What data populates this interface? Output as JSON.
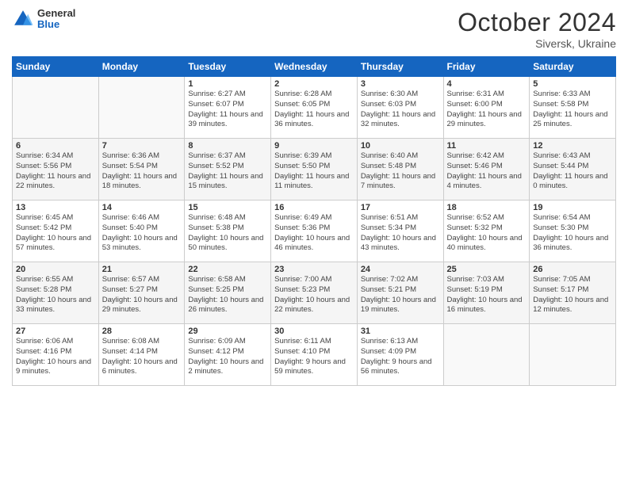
{
  "header": {
    "logo": {
      "general": "General",
      "blue": "Blue"
    },
    "title": "October 2024",
    "location": "Siversk, Ukraine"
  },
  "weekdays": [
    "Sunday",
    "Monday",
    "Tuesday",
    "Wednesday",
    "Thursday",
    "Friday",
    "Saturday"
  ],
  "weeks": [
    [
      {
        "day": "",
        "detail": ""
      },
      {
        "day": "",
        "detail": ""
      },
      {
        "day": "1",
        "detail": "Sunrise: 6:27 AM\nSunset: 6:07 PM\nDaylight: 11 hours and 39 minutes."
      },
      {
        "day": "2",
        "detail": "Sunrise: 6:28 AM\nSunset: 6:05 PM\nDaylight: 11 hours and 36 minutes."
      },
      {
        "day": "3",
        "detail": "Sunrise: 6:30 AM\nSunset: 6:03 PM\nDaylight: 11 hours and 32 minutes."
      },
      {
        "day": "4",
        "detail": "Sunrise: 6:31 AM\nSunset: 6:00 PM\nDaylight: 11 hours and 29 minutes."
      },
      {
        "day": "5",
        "detail": "Sunrise: 6:33 AM\nSunset: 5:58 PM\nDaylight: 11 hours and 25 minutes."
      }
    ],
    [
      {
        "day": "6",
        "detail": "Sunrise: 6:34 AM\nSunset: 5:56 PM\nDaylight: 11 hours and 22 minutes."
      },
      {
        "day": "7",
        "detail": "Sunrise: 6:36 AM\nSunset: 5:54 PM\nDaylight: 11 hours and 18 minutes."
      },
      {
        "day": "8",
        "detail": "Sunrise: 6:37 AM\nSunset: 5:52 PM\nDaylight: 11 hours and 15 minutes."
      },
      {
        "day": "9",
        "detail": "Sunrise: 6:39 AM\nSunset: 5:50 PM\nDaylight: 11 hours and 11 minutes."
      },
      {
        "day": "10",
        "detail": "Sunrise: 6:40 AM\nSunset: 5:48 PM\nDaylight: 11 hours and 7 minutes."
      },
      {
        "day": "11",
        "detail": "Sunrise: 6:42 AM\nSunset: 5:46 PM\nDaylight: 11 hours and 4 minutes."
      },
      {
        "day": "12",
        "detail": "Sunrise: 6:43 AM\nSunset: 5:44 PM\nDaylight: 11 hours and 0 minutes."
      }
    ],
    [
      {
        "day": "13",
        "detail": "Sunrise: 6:45 AM\nSunset: 5:42 PM\nDaylight: 10 hours and 57 minutes."
      },
      {
        "day": "14",
        "detail": "Sunrise: 6:46 AM\nSunset: 5:40 PM\nDaylight: 10 hours and 53 minutes."
      },
      {
        "day": "15",
        "detail": "Sunrise: 6:48 AM\nSunset: 5:38 PM\nDaylight: 10 hours and 50 minutes."
      },
      {
        "day": "16",
        "detail": "Sunrise: 6:49 AM\nSunset: 5:36 PM\nDaylight: 10 hours and 46 minutes."
      },
      {
        "day": "17",
        "detail": "Sunrise: 6:51 AM\nSunset: 5:34 PM\nDaylight: 10 hours and 43 minutes."
      },
      {
        "day": "18",
        "detail": "Sunrise: 6:52 AM\nSunset: 5:32 PM\nDaylight: 10 hours and 40 minutes."
      },
      {
        "day": "19",
        "detail": "Sunrise: 6:54 AM\nSunset: 5:30 PM\nDaylight: 10 hours and 36 minutes."
      }
    ],
    [
      {
        "day": "20",
        "detail": "Sunrise: 6:55 AM\nSunset: 5:28 PM\nDaylight: 10 hours and 33 minutes."
      },
      {
        "day": "21",
        "detail": "Sunrise: 6:57 AM\nSunset: 5:27 PM\nDaylight: 10 hours and 29 minutes."
      },
      {
        "day": "22",
        "detail": "Sunrise: 6:58 AM\nSunset: 5:25 PM\nDaylight: 10 hours and 26 minutes."
      },
      {
        "day": "23",
        "detail": "Sunrise: 7:00 AM\nSunset: 5:23 PM\nDaylight: 10 hours and 22 minutes."
      },
      {
        "day": "24",
        "detail": "Sunrise: 7:02 AM\nSunset: 5:21 PM\nDaylight: 10 hours and 19 minutes."
      },
      {
        "day": "25",
        "detail": "Sunrise: 7:03 AM\nSunset: 5:19 PM\nDaylight: 10 hours and 16 minutes."
      },
      {
        "day": "26",
        "detail": "Sunrise: 7:05 AM\nSunset: 5:17 PM\nDaylight: 10 hours and 12 minutes."
      }
    ],
    [
      {
        "day": "27",
        "detail": "Sunrise: 6:06 AM\nSunset: 4:16 PM\nDaylight: 10 hours and 9 minutes."
      },
      {
        "day": "28",
        "detail": "Sunrise: 6:08 AM\nSunset: 4:14 PM\nDaylight: 10 hours and 6 minutes."
      },
      {
        "day": "29",
        "detail": "Sunrise: 6:09 AM\nSunset: 4:12 PM\nDaylight: 10 hours and 2 minutes."
      },
      {
        "day": "30",
        "detail": "Sunrise: 6:11 AM\nSunset: 4:10 PM\nDaylight: 9 hours and 59 minutes."
      },
      {
        "day": "31",
        "detail": "Sunrise: 6:13 AM\nSunset: 4:09 PM\nDaylight: 9 hours and 56 minutes."
      },
      {
        "day": "",
        "detail": ""
      },
      {
        "day": "",
        "detail": ""
      }
    ]
  ]
}
